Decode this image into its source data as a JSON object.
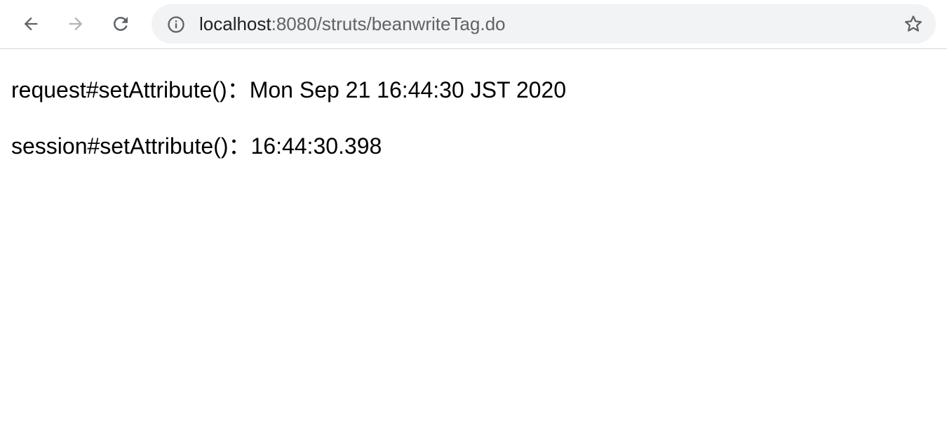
{
  "browser": {
    "url_host": "localhost",
    "url_path": ":8080/struts/beanwriteTag.do",
    "icons": {
      "back": "arrow-left-icon",
      "forward": "arrow-right-icon",
      "reload": "reload-icon",
      "site_info": "info-icon",
      "bookmark": "star-icon"
    },
    "colors": {
      "toolbar_icon": "#5f6368",
      "disabled_icon": "#b0b3b7",
      "omnibox_bg": "#f1f3f4"
    }
  },
  "page": {
    "lines": [
      "request#setAttribute()：Mon Sep 21 16:44:30 JST 2020",
      "session#setAttribute()：16:44:30.398"
    ]
  }
}
